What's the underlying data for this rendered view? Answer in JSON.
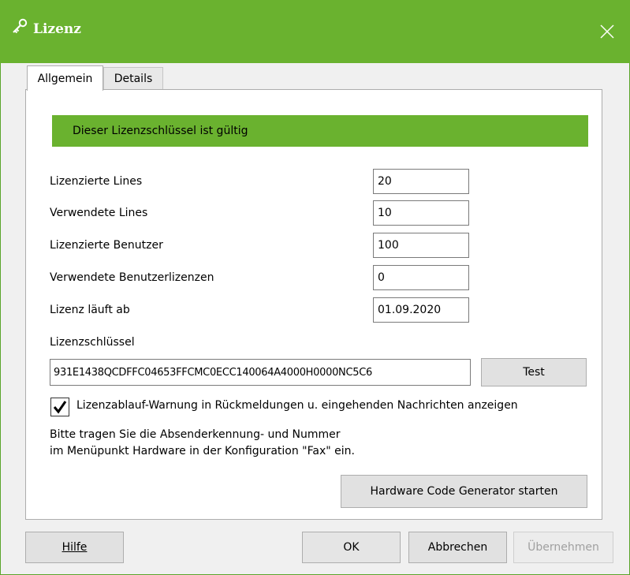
{
  "window": {
    "title": "Lizenz",
    "icon": "key-icon",
    "accent_color": "#6ab22f"
  },
  "tabs": [
    {
      "label": "Allgemein",
      "active": true
    },
    {
      "label": "Details",
      "active": false
    }
  ],
  "status": {
    "text": "Dieser Lizenzschlüssel ist gültig",
    "color": "#6ab22f"
  },
  "fields": [
    {
      "label": "Lizenzierte Lines",
      "value": "20"
    },
    {
      "label": "Verwendete Lines",
      "value": "10"
    },
    {
      "label": "Lizenzierte Benutzer",
      "value": "100"
    },
    {
      "label": "Verwendete Benutzerlizenzen",
      "value": "0"
    },
    {
      "label": "Lizenz läuft ab",
      "value": "01.09.2020"
    }
  ],
  "license_key": {
    "label": "Lizenzschlüssel",
    "value": "931E1438QCDFFC04653FFCMC0ECC140064A4000H0000NC5C6",
    "test_button": "Test"
  },
  "warning_checkbox": {
    "checked": true,
    "label": "Lizenzablauf-Warnung in Rückmeldungen u. eingehenden Nachrichten anzeigen"
  },
  "info_lines": [
    "Bitte tragen Sie die Absenderkennung- und Nummer",
    "im Menüpunkt Hardware in der Konfiguration \"Fax\" ein."
  ],
  "hardware_button": "Hardware Code Generator starten",
  "footer": {
    "help": "Hilfe",
    "ok": "OK",
    "cancel": "Abbrechen",
    "apply": "Übernehmen"
  }
}
